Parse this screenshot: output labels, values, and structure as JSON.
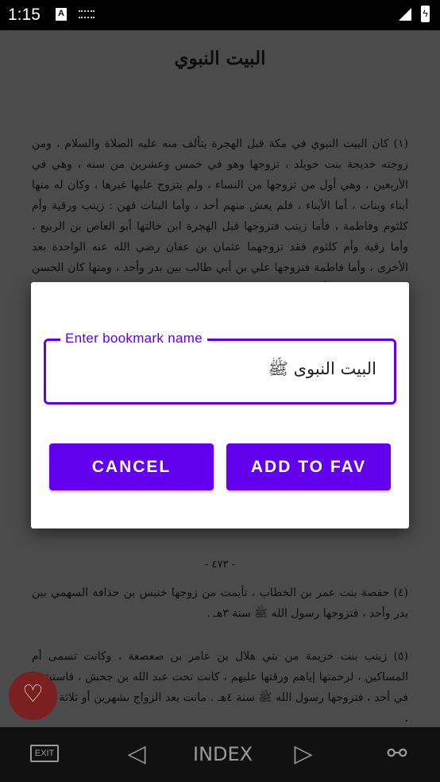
{
  "status_bar": {
    "time": "1:15",
    "icons": [
      "a-icon",
      "keyboard-icon",
      "signal-off-icon",
      "battery-charging-icon"
    ],
    "a_label": "A"
  },
  "page": {
    "title": "البيت النبوي",
    "paragraph1": "(١) كان البيت النبوي في مكة قبل الهجرة يتألف منه عليه الصلاة والسلام ، ومن زوجته خديجة بنت خويلد ، تزوجها وهو في خمس وعشرين من سنه ، وهي في الأربعين ، وهي أول من تزوجها من النساء ، ولم يتزوج عليها غيرها ، وكان له منها أبناء وبنات ، أما الأبناء ، فلم يعش منهم أحد ، وأما البنات فهن : زينب ورقية وأم كلثوم وفاطمة ، فأما زينب فتزوجها قبل الهجرة ابن خالتها أبو العاص بن الربيع ، وأما رقية وأم كلثوم فقد تزوجهما عثمان بن عفان رضي الله عنه الواحدة بعد الأخرى ، وأما فاطمة فتزوجها علي بن أبي طالب بين بدر وأحد ، ومنها كان الحسن والحسين وزينب وأم كلثوم .",
    "page_number": "- ٤٧٣ -",
    "paragraph4": "(٤) حفصة بنت عمر بن الخطاب ، تأيمت من زوجها خنيس بن حذافة السهمي بين بدر وأحد ، فتزوجها رسول الله ﷺ سنة ٣هـ .",
    "paragraph5": "(٥) زينب بنت خزيمة من بني هلال بن عامر بن صعصعة ، وكانت تسمى أم المساكين ، لرحمتها إياهم ورقتها عليهم ، كانت تحت عبد الله بن جحش ، فاستشهد في أحد ، فتزوجها رسول الله ﷺ سنة ٤هـ . ماتت بعد الزواج بشهرين أو ثلاثة أشهر ."
  },
  "dialog": {
    "field_label": "Enter bookmark name",
    "field_value": "البيت النبوى ﷺ",
    "cancel_label": "CANCEL",
    "add_label": "ADD TO FAV",
    "accent_color": "#6200ee"
  },
  "fab": {
    "icon": "heart-add-icon"
  },
  "bottom_bar": {
    "exit_label": "EXIT",
    "index_label": "INDEX",
    "prev_icon": "triangle-left-icon",
    "next_icon": "triangle-right-icon",
    "share_icon": "share-icon"
  }
}
